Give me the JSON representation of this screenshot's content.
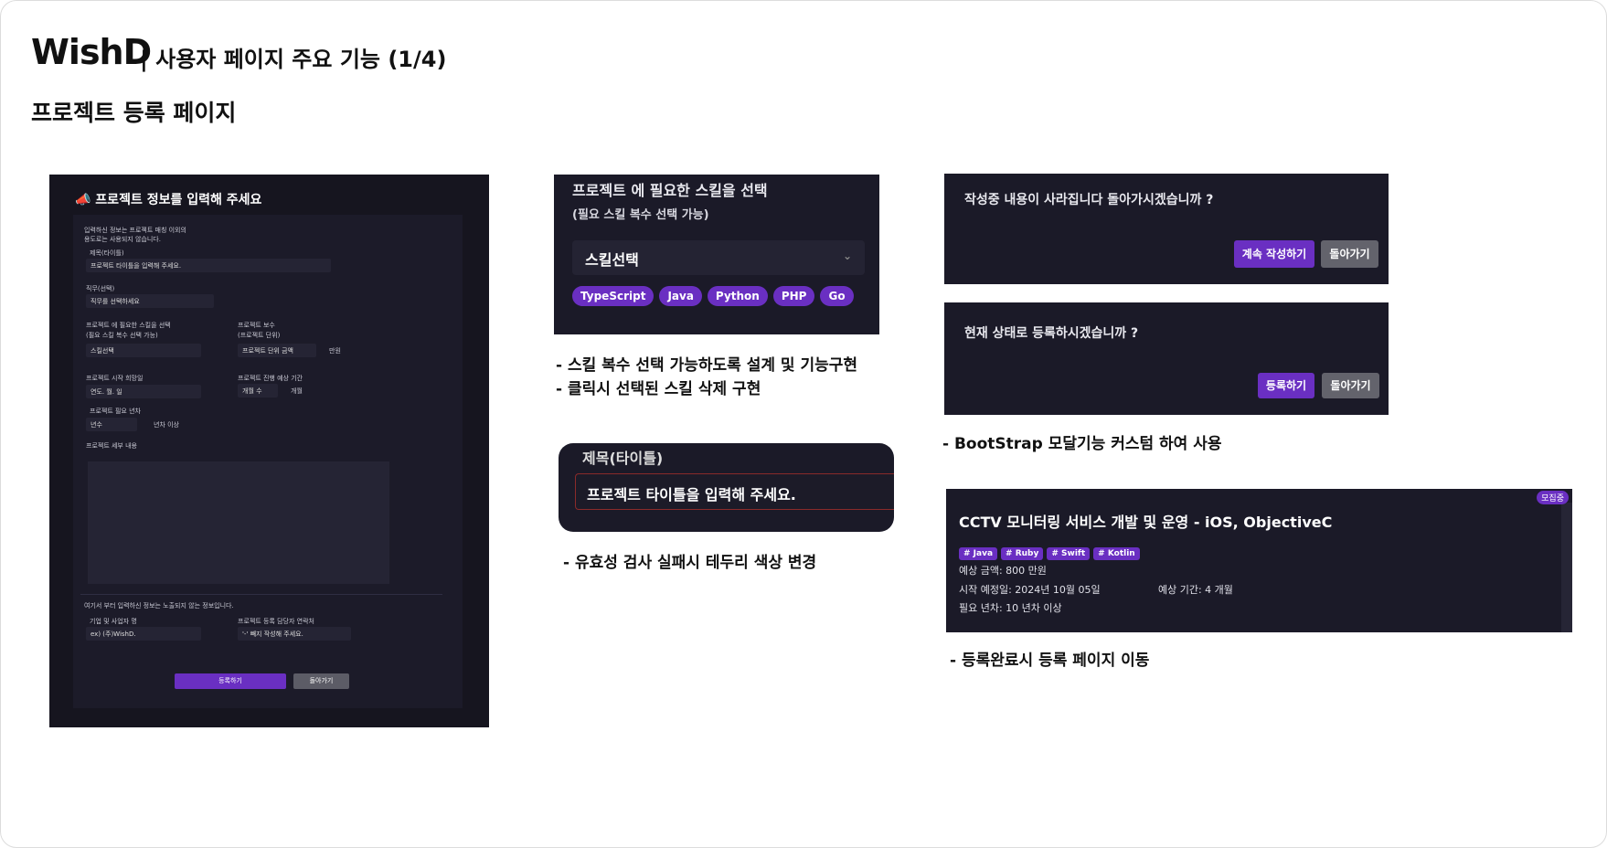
{
  "header": {
    "brand": "WishD",
    "title": "| 사용자 페이지 주요 기능 (1/4)",
    "section": "프로젝트 등록 페이지"
  },
  "form": {
    "title": "📣 프로젝트 정보를 입력해 주세요",
    "notice_line1": "입력하신 정보는 프로젝트 매칭 이외의",
    "notice_line2": "용도로는 사용되지 않습니다.",
    "title_label": "제목(타이틀)",
    "title_placeholder": "프로젝트 타이틀을 입력해 주세요.",
    "job_label": "직무(선택)",
    "job_value": "직무를 선택하세요",
    "skill_label": "프로젝트 에 필요한 스킬을 선택",
    "skill_sub": "(필요 스킬 복수 선택 가능)",
    "skill_value": "스킬선택",
    "pay_label": "프로젝트 보수",
    "pay_sub": "(프로젝트 단위)",
    "pay_value": "프로젝트 단위 금액",
    "pay_unit": "만원",
    "start_label": "프로젝트 시작 희망일",
    "start_value": "연도. 월. 일",
    "period_label": "프로젝트 진행 예상 기간",
    "period_value": "개월 수",
    "period_unit": "개월",
    "years_label": "프로젝트 필요 년차",
    "years_value": "년수",
    "years_unit": "년차 이상",
    "detail_label": "프로젝트 세부 내용",
    "private_notice": "여기서 부터 입력하신 정보는 노출되지 않는 정보입니다.",
    "company_label": "기업 및 사업자 명",
    "company_value": "ex) (주)WishD.",
    "contact_label": "프로젝트 등록 담당자 연락처",
    "contact_value": "'-' 빼지 작성해 주세요.",
    "submit": "등록하기",
    "back": "돌아가기"
  },
  "skill_panel": {
    "title": "프로젝트 에 필요한 스킬을 선택",
    "subtitle": "(필요 스킬 복수 선택 가능)",
    "select": "스킬선택",
    "chips": [
      "TypeScript",
      "Java",
      "Python",
      "PHP",
      "Go"
    ]
  },
  "notes": {
    "skill_note1": "- 스킬 복수 선택 가능하도록 설계 및 기능구현",
    "skill_note2": "- 클릭시 선택된 스킬 삭제 구현",
    "validation_note": "- 유효성 검사 실패시 테두리 색상 변경",
    "modal_note": "- BootStrap 모달기능 커스텀 하여 사용",
    "card_note": "- 등록완료시 등록 페이지 이동"
  },
  "title_panel": {
    "label": "제목(타이틀)",
    "placeholder": "프로젝트 타이틀을 입력해 주세요."
  },
  "modal_leave": {
    "text": "작성중 내용이 사라집니다 돌아가시겠습니까 ?",
    "continue": "계속 작성하기",
    "back": "돌아가기"
  },
  "modal_register": {
    "text": "현재 상태로 등록하시겠습니까 ?",
    "submit": "등록하기",
    "back": "돌아가기"
  },
  "card": {
    "badge": "모집중",
    "title": "CCTV 모니터링 서비스 개발 및 운영 - iOS, ObjectiveC",
    "tags": [
      "# Java",
      "# Ruby",
      "# Swift",
      "# Kotlin"
    ],
    "amount": "예상 금액: 800 만원",
    "start": "시작 예정일: 2024년 10월 05일",
    "period": "예상 기간: 4 개월",
    "years": "필요 년차: 10 년차 이상"
  },
  "colors": {
    "accent": "#6a2fc2",
    "panel": "#1b1a28",
    "error_border": "#8a2a2a"
  }
}
